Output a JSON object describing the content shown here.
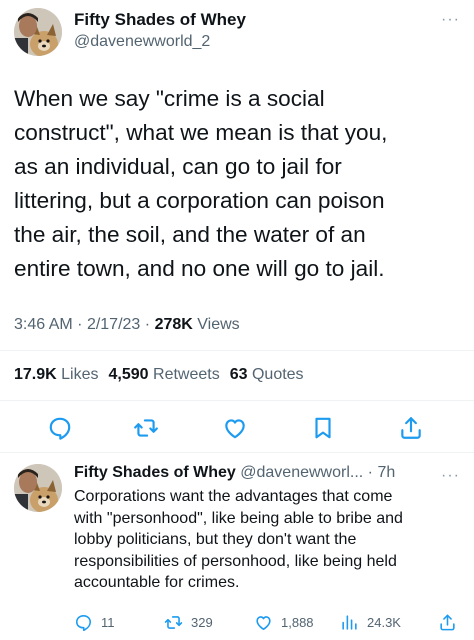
{
  "main_tweet": {
    "display_name": "Fifty Shades of Whey",
    "handle": "@davenewworld_2",
    "more": "···",
    "text": "When we say \"crime is a social\nconstruct\", what we mean is that you,\nas an individual, can go to jail for\nlittering, but a corporation can poison\nthe air, the soil, and the water of an\nentire town, and no one will go to jail.",
    "time": "3:46 AM",
    "date": "2/17/23",
    "separator": "·",
    "views_count": "278K",
    "views_label": "Views",
    "likes_count": "17.9K",
    "likes_label": "Likes",
    "retweets_count": "4,590",
    "retweets_label": "Retweets",
    "quotes_count": "63",
    "quotes_label": "Quotes",
    "action_icons": [
      "reply-icon",
      "retweet-icon",
      "like-icon",
      "bookmark-icon",
      "share-icon"
    ]
  },
  "reply": {
    "display_name": "Fifty Shades of Whey",
    "handle": "@davenewworl...",
    "separator": "·",
    "age": "7h",
    "more": "···",
    "text": "Corporations want the advantages that come\nwith \"personhood\", like being able to bribe and\nlobby politicians, but they don't want the\nresponsibilities of personhood, like being held\naccountable for crimes.",
    "reply_count": "11",
    "retweet_count": "329",
    "like_count": "1,888",
    "view_count": "24.3K"
  },
  "colors": {
    "text_primary": "#0f1419",
    "text_secondary": "#536471",
    "divider": "#eff3f4",
    "accent": "#1d9bf0"
  }
}
